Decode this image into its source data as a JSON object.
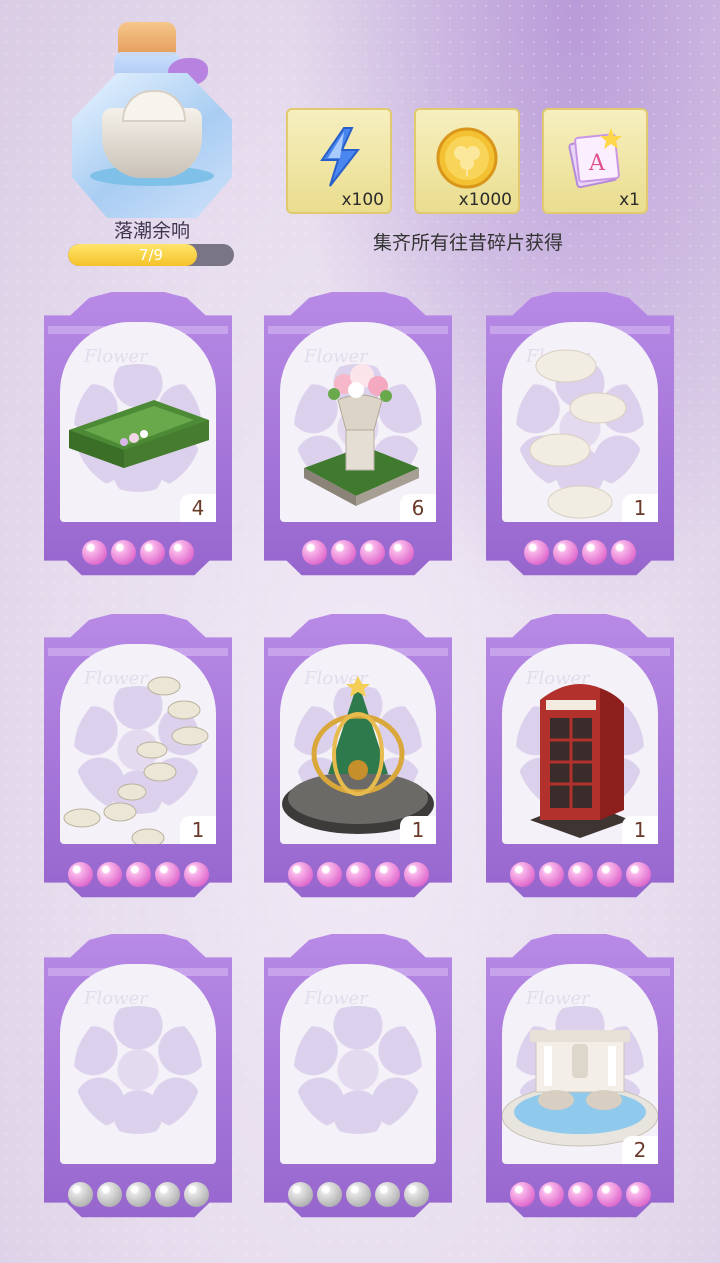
{
  "collection": {
    "name": "落潮余响",
    "progress_text": "7/9",
    "progress": 0.78
  },
  "rewards": [
    {
      "icon": "lightning-icon",
      "count": "x100"
    },
    {
      "icon": "gold-coin-icon",
      "count": "x1000"
    },
    {
      "icon": "design-book-icon",
      "count": "x1"
    }
  ],
  "rewards_caption": "集齐所有往昔碎片获得",
  "cards": [
    {
      "item": "hedge-garden",
      "count": "4",
      "pearls": 4,
      "pearl_color": "pink"
    },
    {
      "item": "flower-urn-planter",
      "count": "6",
      "pearls": 4,
      "pearl_color": "pink"
    },
    {
      "item": "round-stepping-stones",
      "count": "1",
      "pearls": 4,
      "pearl_color": "pink"
    },
    {
      "item": "rock-stepping-path",
      "count": "1",
      "pearls": 5,
      "pearl_color": "pink"
    },
    {
      "item": "golden-armillary-tree",
      "count": "1",
      "pearls": 5,
      "pearl_color": "pink"
    },
    {
      "item": "red-telephone-booth",
      "count": "1",
      "pearls": 5,
      "pearl_color": "pink"
    },
    {
      "item": "empty-slot",
      "count": "",
      "pearls": 5,
      "pearl_color": "grey"
    },
    {
      "item": "empty-slot",
      "count": "",
      "pearls": 5,
      "pearl_color": "grey"
    },
    {
      "item": "trevi-fountain",
      "count": "2",
      "pearls": 5,
      "pearl_color": "pink"
    }
  ],
  "colors": {
    "card_frame": "#a274d8",
    "pearl_pink": "#e16fcf",
    "pearl_grey": "#b6b6b6",
    "reward_bg": "#f0e6a8",
    "progress_fill": "#f4c22a"
  }
}
